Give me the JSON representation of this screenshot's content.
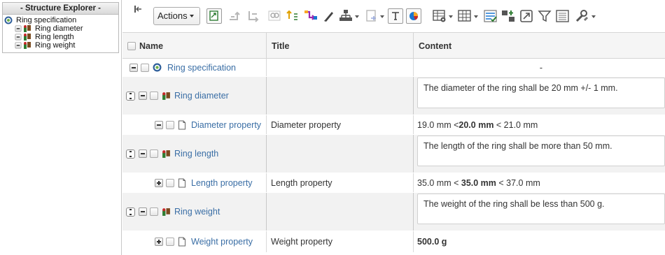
{
  "explorer": {
    "title": "- Structure Explorer -",
    "root": "Ring specification",
    "items": [
      {
        "label": "Ring diameter"
      },
      {
        "label": "Ring length"
      },
      {
        "label": "Ring weight"
      }
    ]
  },
  "toolbar": {
    "actions_label": "Actions",
    "icons": [
      "collapse-panel-icon",
      "export-icon",
      "compare-icon",
      "copy-icon",
      "find-icon",
      "sort-icon",
      "flow-icon",
      "edit-pencil-icon",
      "hierarchy-icon",
      "insert-icon",
      "text-field-icon",
      "chart-icon",
      "table-settings-icon",
      "view-grid-icon",
      "checklist-icon",
      "add-column-icon",
      "open-window-icon",
      "filter-icon",
      "table-layout-icon",
      "tools-icon"
    ]
  },
  "grid": {
    "headers": {
      "name": "Name",
      "title": "Title",
      "content": "Content"
    },
    "rows": [
      {
        "name": "Ring specification",
        "title": "",
        "content": "-"
      },
      {
        "name": "Ring diameter",
        "title": "",
        "content": "The diameter of the ring shall be 20 mm +/- 1 mm."
      },
      {
        "name": "Diameter property",
        "title": "Diameter property",
        "content_pre": "19.0 mm < ",
        "content_bold": "20.0 mm",
        "content_post": " < 21.0 mm"
      },
      {
        "name": "Ring length",
        "title": "",
        "content": "The length of the ring shall be more than 50 mm."
      },
      {
        "name": "Length property",
        "title": "Length property",
        "content_pre": "35.0 mm < ",
        "content_bold": "35.0 mm",
        "content_post": " < 37.0 mm"
      },
      {
        "name": "Ring weight",
        "title": "",
        "content": "The weight of the ring shall be less than 500 g."
      },
      {
        "name": "Weight property",
        "title": "Weight property",
        "content_bold": "500.0 g"
      }
    ]
  },
  "colors": {
    "link": "#3a6ea5",
    "alt_row": "#f2f2f2",
    "header_bg": "#f5f5f5"
  }
}
